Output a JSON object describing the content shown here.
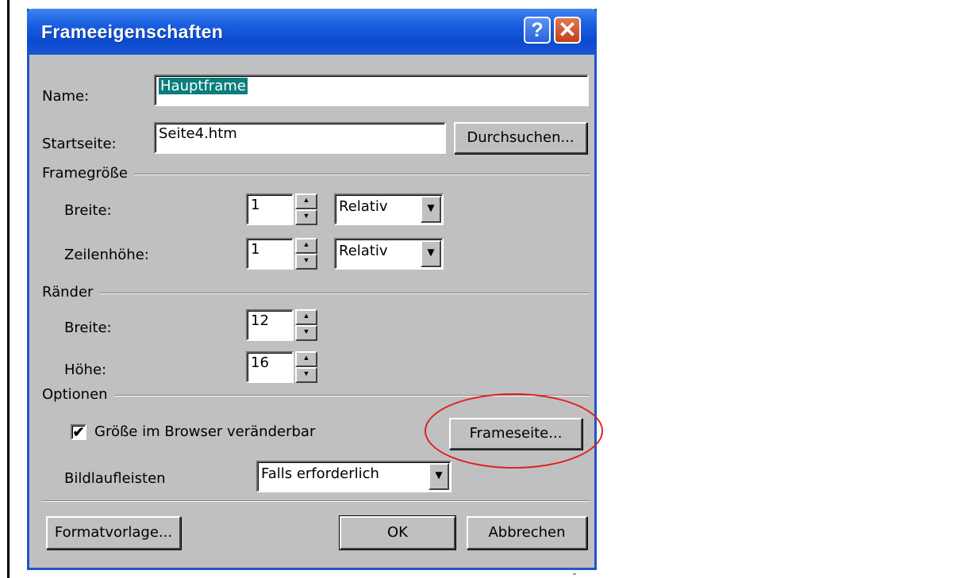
{
  "dialog": {
    "title": "Frameeigenschaften",
    "help_label": "?",
    "close_label": "✕"
  },
  "name": {
    "label": "Name:",
    "value": "Hauptframe"
  },
  "startseite": {
    "label": "Startseite:",
    "value": "Seite4.htm",
    "browse_label": "Durchsuchen..."
  },
  "framegroesse": {
    "heading": "Framegröße",
    "breite": {
      "label": "Breite:",
      "value": "1",
      "unit": "Relativ"
    },
    "zeilenhoehe": {
      "label": "Zeilenhöhe:",
      "value": "1",
      "unit": "Relativ"
    }
  },
  "raender": {
    "heading": "Ränder",
    "breite": {
      "label": "Breite:",
      "value": "12"
    },
    "hoehe": {
      "label": "Höhe:",
      "value": "16"
    }
  },
  "optionen": {
    "heading": "Optionen",
    "resizable_label": "Größe im Browser veränderbar",
    "resizable_checked": true,
    "check_mark": "✔",
    "frameseite_label": "Frameseite...",
    "scrollbars_label": "Bildlaufleisten",
    "scrollbars_value": "Falls erforderlich"
  },
  "footer": {
    "format_label": "Formatvorlage...",
    "ok_label": "OK",
    "cancel_label": "Abbrechen"
  },
  "icons": {
    "spin_up": "▲",
    "spin_down": "▼",
    "dropdown_arrow": "▼"
  },
  "colors": {
    "title_bar": "#1a5ee0",
    "selection": "#0a7e7c",
    "annotation": "#e02020"
  }
}
